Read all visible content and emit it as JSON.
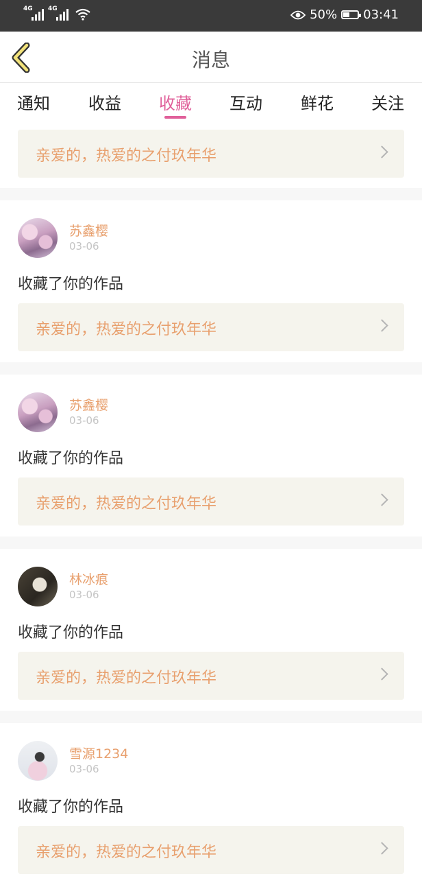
{
  "status": {
    "net1": "4G",
    "net2": "4G",
    "battery_text": "50%",
    "battery_level": 0.5,
    "time": "03:41",
    "icons": [
      "signal-icon",
      "signal-icon",
      "wifi-icon",
      "eye-icon",
      "battery-icon"
    ]
  },
  "header": {
    "title": "消息",
    "back_icon": "chevron-left-icon"
  },
  "tabs": [
    {
      "label": "通知"
    },
    {
      "label": "收益"
    },
    {
      "label": "收藏",
      "active": true
    },
    {
      "label": "互动"
    },
    {
      "label": "鲜花"
    },
    {
      "label": "关注"
    }
  ],
  "top_card": {
    "work_title": "亲爱的，热爱的之付玖年华"
  },
  "messages": [
    {
      "user": "苏鑫樱",
      "date": "03-06",
      "action": "收藏了你的作品",
      "work_title": "亲爱的，热爱的之付玖年华"
    },
    {
      "user": "苏鑫樱",
      "date": "03-06",
      "action": "收藏了你的作品",
      "work_title": "亲爱的，热爱的之付玖年华"
    },
    {
      "user": "林冰痕",
      "date": "03-06",
      "action": "收藏了你的作品",
      "work_title": "亲爱的，热爱的之付玖年华"
    },
    {
      "user": "雪源1234",
      "date": "03-06",
      "action": "收藏了你的作品",
      "work_title": "亲爱的，热爱的之付玖年华"
    }
  ],
  "colors": {
    "accent": "#e0609a",
    "username": "#e8a06e",
    "card_bg": "#f5f4ed",
    "status_bar": "#3a3a3a",
    "back_icon_fill": "#f2e27a"
  }
}
